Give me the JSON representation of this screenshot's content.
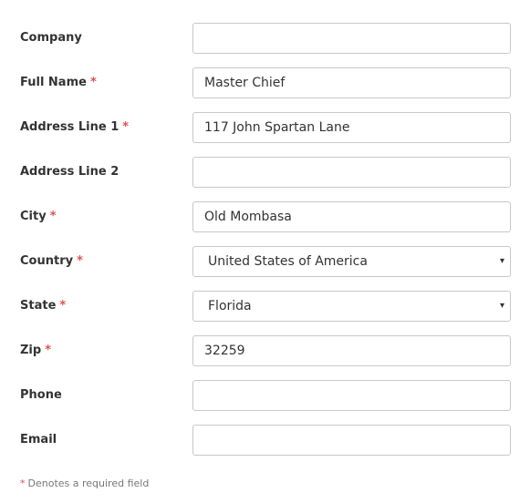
{
  "form": {
    "company": {
      "label": "Company",
      "value": "",
      "required_mark": ""
    },
    "full_name": {
      "label": "Full Name",
      "value": "Master Chief",
      "required_mark": "*"
    },
    "address1": {
      "label": "Address Line 1",
      "value": "117 John Spartan Lane",
      "required_mark": "*"
    },
    "address2": {
      "label": "Address Line 2",
      "value": "",
      "required_mark": ""
    },
    "city": {
      "label": "City",
      "value": "Old Mombasa",
      "required_mark": "*"
    },
    "country": {
      "label": "Country",
      "selected": "United States of America",
      "required_mark": "*",
      "caret": "▾"
    },
    "state": {
      "label": "State",
      "selected": "Florida",
      "required_mark": "*",
      "caret": "▾"
    },
    "zip": {
      "label": "Zip",
      "value": "32259",
      "required_mark": "*"
    },
    "phone": {
      "label": "Phone",
      "value": "",
      "required_mark": ""
    },
    "email": {
      "label": "Email",
      "value": "",
      "required_mark": ""
    }
  },
  "footnote": {
    "mark": "*",
    "text": "Denotes a required field"
  },
  "colors": {
    "required": "#d9534f",
    "border": "#c8c8c8",
    "text": "#333333"
  },
  "icons": {
    "select_caret": "caret-down-icon"
  }
}
